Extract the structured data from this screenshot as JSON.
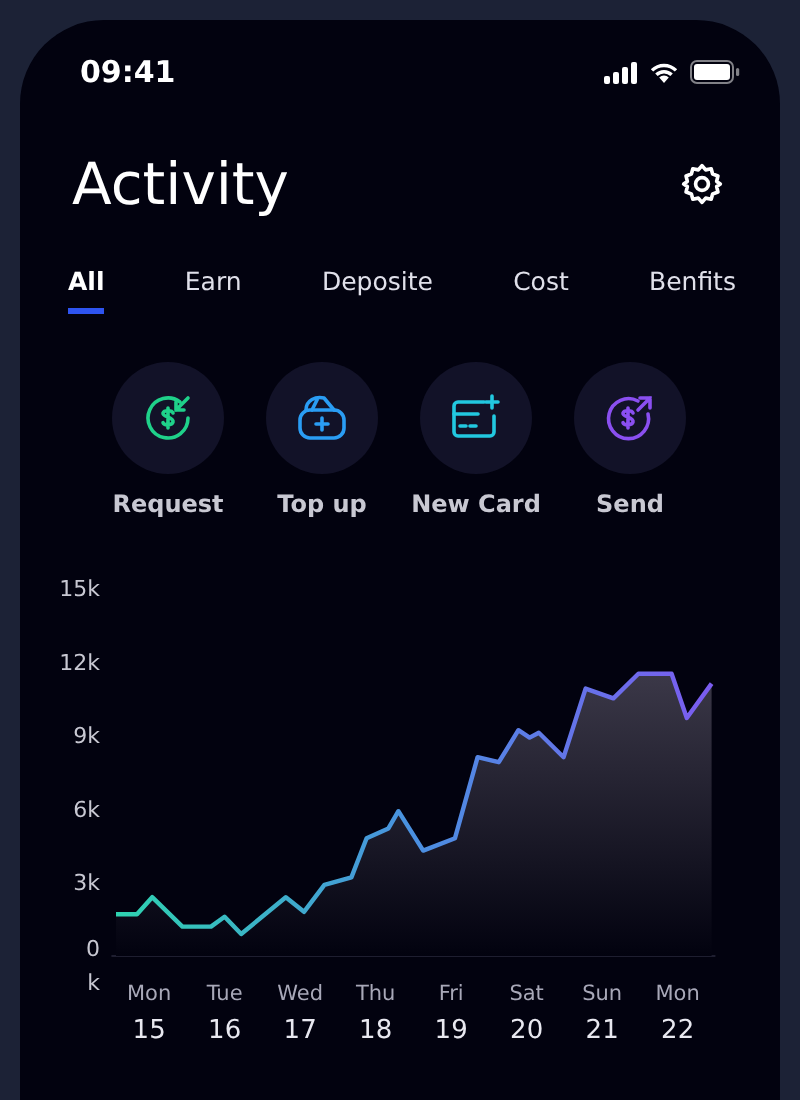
{
  "status_bar": {
    "time": "09:41"
  },
  "title": "Activity",
  "tabs": [
    {
      "label": "All",
      "selected": true
    },
    {
      "label": "Earn",
      "selected": false
    },
    {
      "label": "Deposite",
      "selected": false
    },
    {
      "label": "Cost",
      "selected": false
    },
    {
      "label": "Benfits",
      "selected": false
    }
  ],
  "actions": [
    {
      "label": "Request",
      "kind": "request",
      "color": "#1fd18a"
    },
    {
      "label": "Top up",
      "kind": "topup",
      "color": "#2a9df4"
    },
    {
      "label": "New Card",
      "kind": "card",
      "color": "#22c8e0"
    },
    {
      "label": "Send",
      "kind": "send",
      "color": "#8a4ff0"
    }
  ],
  "chart_data": {
    "type": "area",
    "xlim": [
      14.5,
      22.5
    ],
    "ylim": [
      0,
      15
    ],
    "yticks": [
      {
        "value": 0,
        "label": "0 k"
      },
      {
        "value": 3,
        "label": "3k"
      },
      {
        "value": 6,
        "label": "6k"
      },
      {
        "value": 9,
        "label": "9k"
      },
      {
        "value": 12,
        "label": "12k"
      },
      {
        "value": 15,
        "label": "15k"
      }
    ],
    "x": [
      14.56,
      14.84,
      15.04,
      15.44,
      15.82,
      16.0,
      16.22,
      16.81,
      17.05,
      17.32,
      17.68,
      17.88,
      18.17,
      18.3,
      18.63,
      19.05,
      19.35,
      19.63,
      19.89,
      20.04,
      20.16,
      20.49,
      20.78,
      21.15,
      21.48,
      21.92,
      22.12,
      22.45
    ],
    "series": [
      {
        "color": "#7b5cf0",
        "values": [
          1.7,
          1.7,
          2.4,
          1.2,
          1.2,
          1.6,
          0.9,
          2.4,
          1.8,
          2.9,
          3.2,
          4.8,
          5.2,
          5.9,
          4.3,
          4.8,
          8.1,
          7.9,
          9.2,
          8.9,
          9.1,
          8.1,
          10.9,
          10.5,
          11.5,
          11.5,
          9.7,
          11.1
        ]
      }
    ],
    "xticks": [
      15,
      16,
      17,
      18,
      19,
      20,
      21,
      22
    ]
  },
  "chart_weekdays": [
    "Mon",
    "Tue",
    "Wed",
    "Thu",
    "Fri",
    "Sat",
    "Sun",
    "Mon"
  ]
}
